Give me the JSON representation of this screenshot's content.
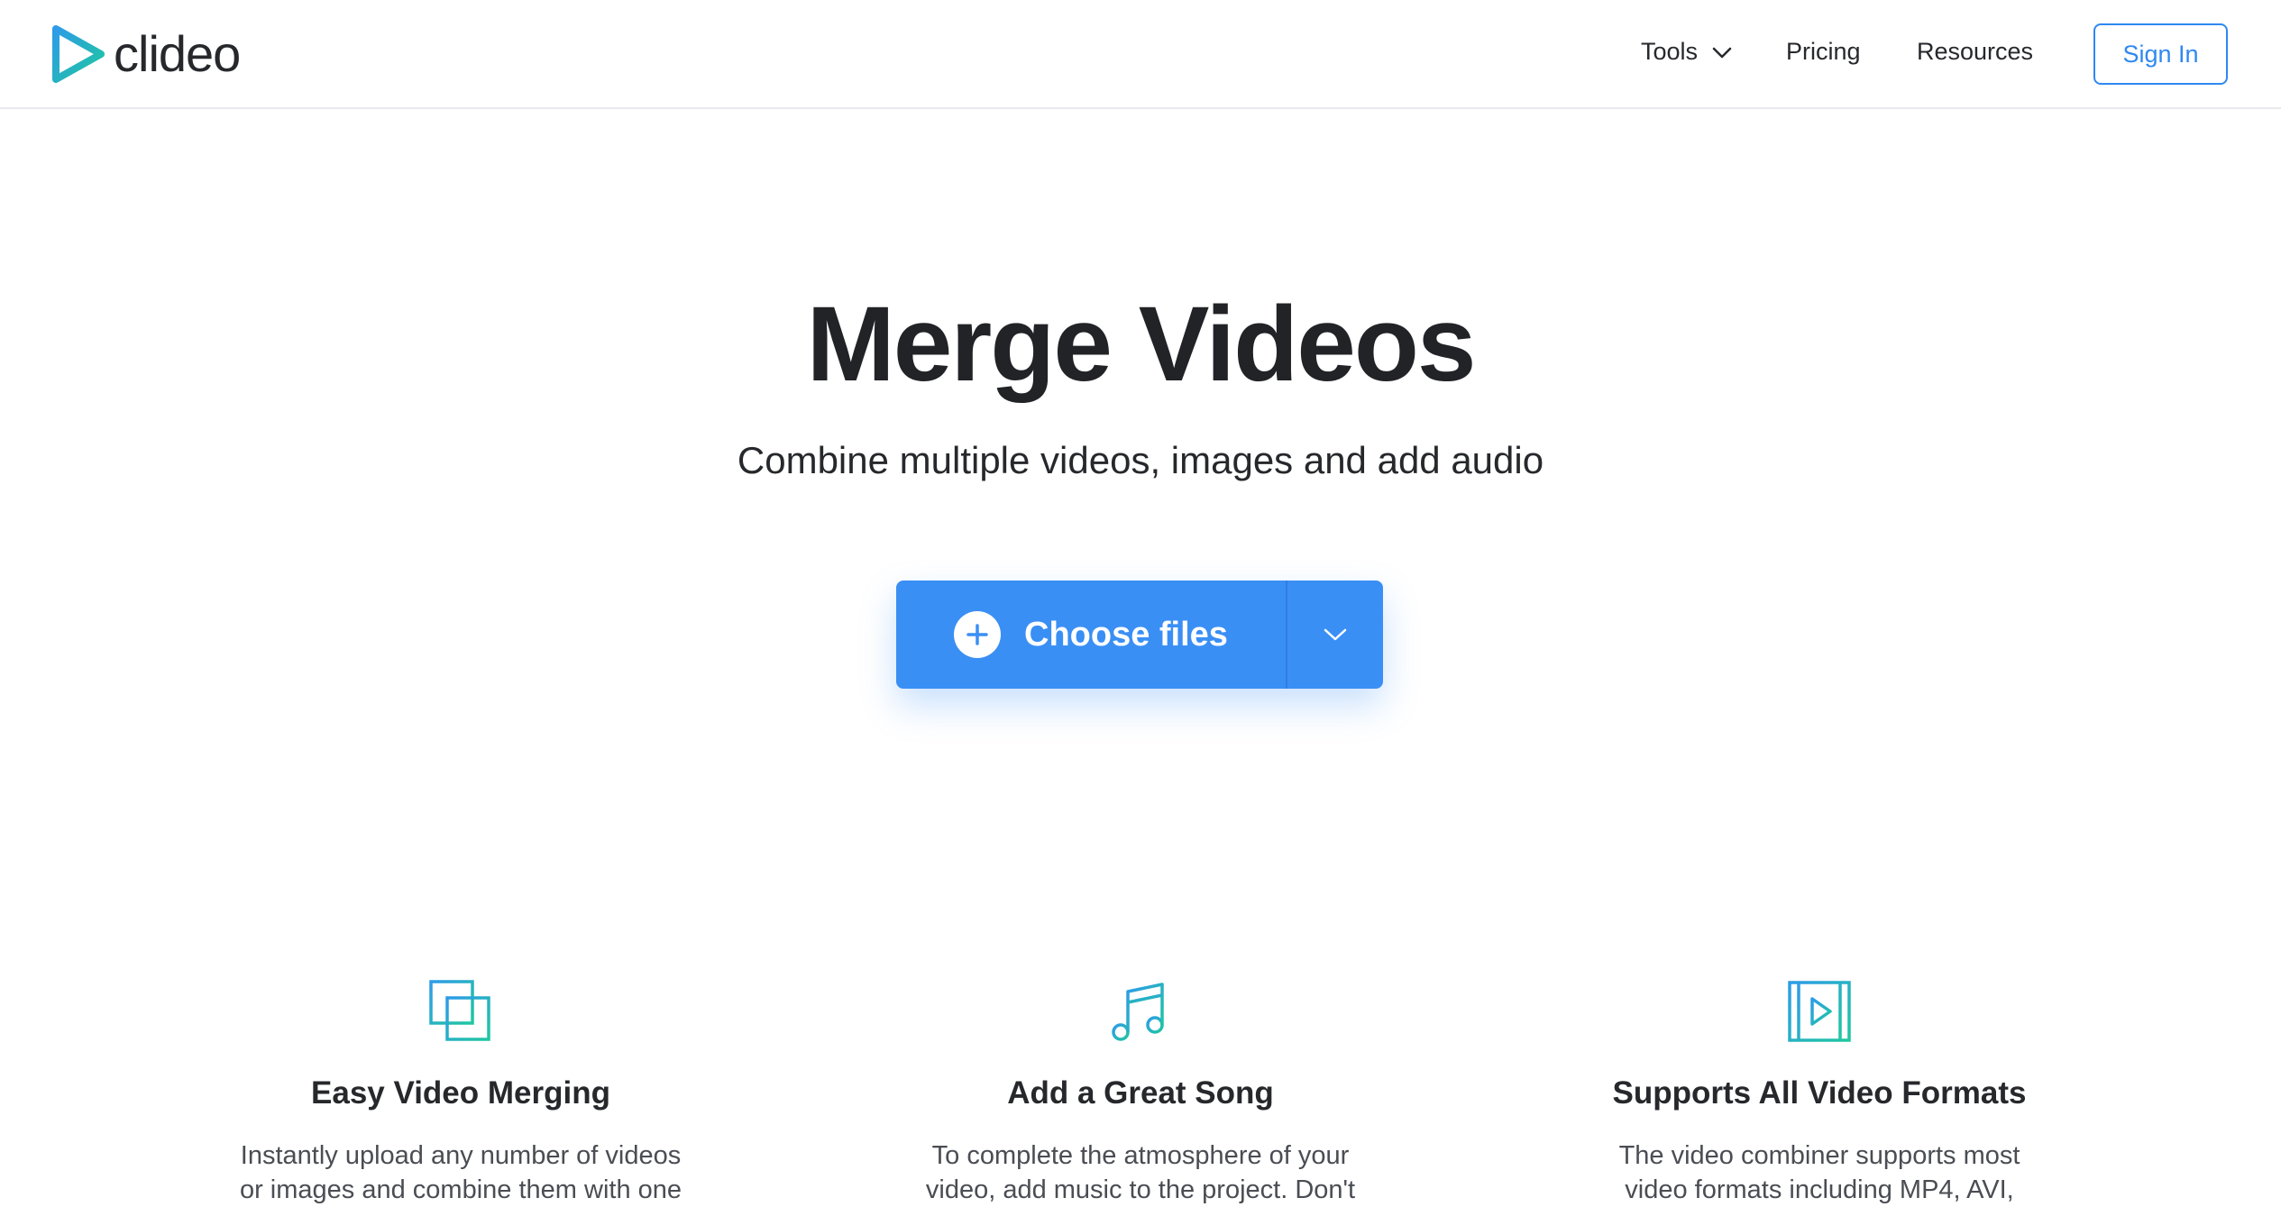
{
  "brand": {
    "name": "clideo"
  },
  "nav": {
    "tools": "Tools",
    "pricing": "Pricing",
    "resources": "Resources",
    "sign_in": "Sign In"
  },
  "hero": {
    "title": "Merge Videos",
    "subtitle": "Combine multiple videos, images and add audio",
    "upload_label": "Choose files"
  },
  "features": [
    {
      "icon": "overlapping-squares-icon",
      "title": "Easy Video Merging",
      "description": "Instantly upload any number of videos or images and combine them with one"
    },
    {
      "icon": "music-note-icon",
      "title": "Add a Great Song",
      "description": "To complete the atmosphere of your video, add music to the project. Don't"
    },
    {
      "icon": "film-play-icon",
      "title": "Supports All Video Formats",
      "description": "The video combiner supports most video formats including MP4, AVI,"
    }
  ],
  "colors": {
    "accent": "#3a8ff5",
    "sign_in_border": "#2f88f0",
    "icon_gradient_start": "#2e9be8",
    "icon_gradient_end": "#1fc7a0",
    "text": "#26282c"
  }
}
